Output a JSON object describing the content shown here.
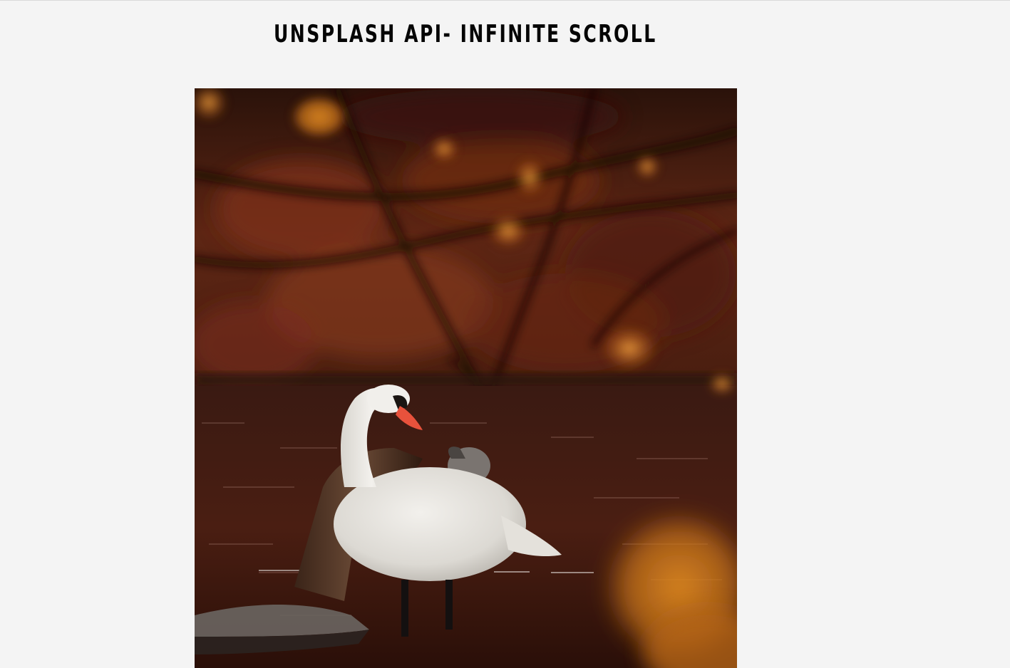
{
  "header": {
    "title": "UNSPLASH API- INFINITE SCROLL"
  },
  "gallery": {
    "images": [
      {
        "subject": "swan-icon",
        "colors": {
          "foliage": "#6b2a14",
          "shadow": "#1c0d08",
          "water": "#3a1810",
          "leaf_accent": "#d9831e",
          "swan": "#e8e6e1",
          "beak": "#e8523c"
        }
      }
    ]
  }
}
